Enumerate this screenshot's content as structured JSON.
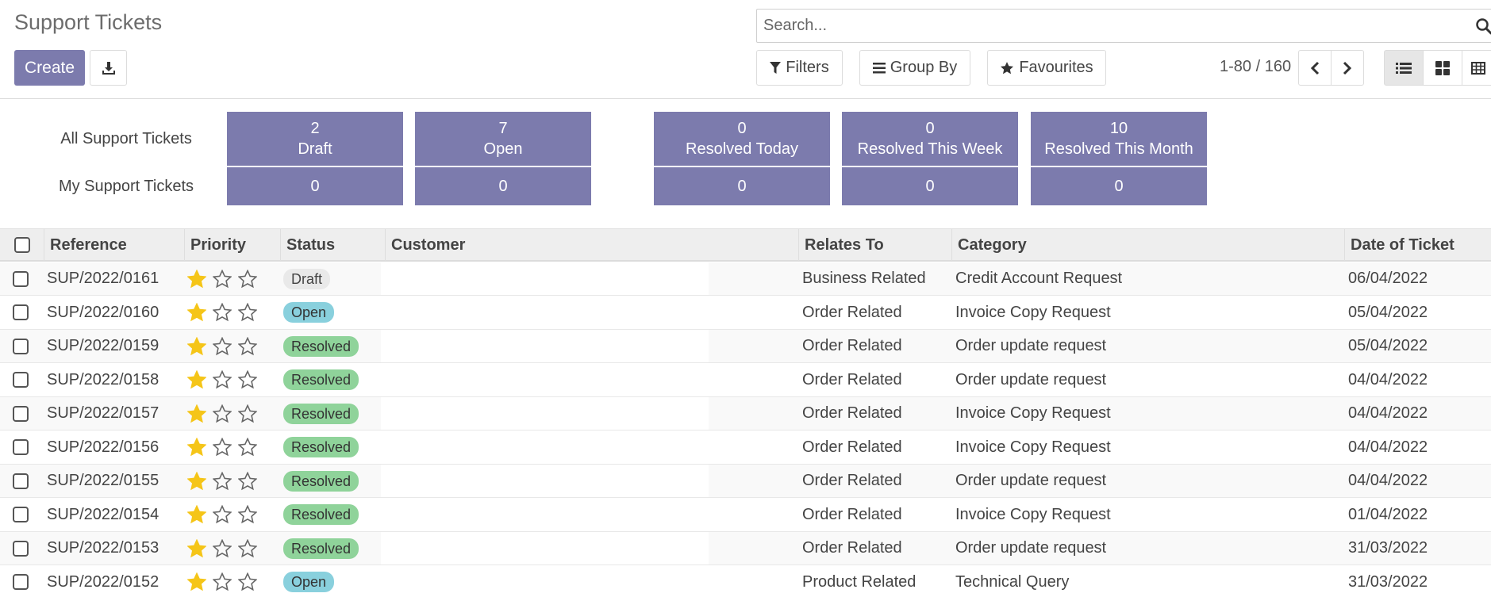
{
  "header": {
    "title": "Support Tickets",
    "create_label": "Create",
    "search_placeholder": "Search...",
    "filters_label": "Filters",
    "groupby_label": "Group By",
    "favourites_label": "Favourites",
    "pager": "1-80 / 160"
  },
  "dashboard": {
    "row_all_label": "All Support Tickets",
    "row_my_label": "My Support Tickets",
    "tiles": [
      {
        "name": "Draft",
        "all": "2",
        "mine": "0"
      },
      {
        "name": "Open",
        "all": "7",
        "mine": "0"
      },
      {
        "name": "Resolved Today",
        "all": "0",
        "mine": "0"
      },
      {
        "name": "Resolved This Week",
        "all": "0",
        "mine": "0"
      },
      {
        "name": "Resolved This Month",
        "all": "10",
        "mine": "0"
      }
    ],
    "tile_color": "#7c7bad"
  },
  "table": {
    "columns": [
      "Reference",
      "Priority",
      "Status",
      "Customer",
      "Relates To",
      "Category",
      "Date of Ticket"
    ],
    "rows": [
      {
        "reference": "SUP/2022/0161",
        "priority": 1,
        "status": "Draft",
        "relates_to": "Business Related",
        "category": "Credit Account Request",
        "date": "06/04/2022"
      },
      {
        "reference": "SUP/2022/0160",
        "priority": 1,
        "status": "Open",
        "relates_to": "Order Related",
        "category": "Invoice Copy Request",
        "date": "05/04/2022"
      },
      {
        "reference": "SUP/2022/0159",
        "priority": 1,
        "status": "Resolved",
        "relates_to": "Order Related",
        "category": "Order update request",
        "date": "05/04/2022"
      },
      {
        "reference": "SUP/2022/0158",
        "priority": 1,
        "status": "Resolved",
        "relates_to": "Order Related",
        "category": "Order update request",
        "date": "04/04/2022"
      },
      {
        "reference": "SUP/2022/0157",
        "priority": 1,
        "status": "Resolved",
        "relates_to": "Order Related",
        "category": "Invoice Copy Request",
        "date": "04/04/2022"
      },
      {
        "reference": "SUP/2022/0156",
        "priority": 1,
        "status": "Resolved",
        "relates_to": "Order Related",
        "category": "Invoice Copy Request",
        "date": "04/04/2022"
      },
      {
        "reference": "SUP/2022/0155",
        "priority": 1,
        "status": "Resolved",
        "relates_to": "Order Related",
        "category": "Order update request",
        "date": "04/04/2022"
      },
      {
        "reference": "SUP/2022/0154",
        "priority": 1,
        "status": "Resolved",
        "relates_to": "Order Related",
        "category": "Invoice Copy Request",
        "date": "01/04/2022"
      },
      {
        "reference": "SUP/2022/0153",
        "priority": 1,
        "status": "Resolved",
        "relates_to": "Order Related",
        "category": "Order update request",
        "date": "31/03/2022"
      },
      {
        "reference": "SUP/2022/0152",
        "priority": 1,
        "status": "Open",
        "relates_to": "Product Related",
        "category": "Technical Query",
        "date": "31/03/2022"
      }
    ]
  },
  "icons": {
    "download": "download-icon",
    "search": "search-icon",
    "filter": "filter-icon",
    "groupby": "bars-icon",
    "favourites": "star-icon",
    "prev": "chevron-left-icon",
    "next": "chevron-right-icon",
    "list_view": "list-view-icon",
    "kanban_view": "kanban-view-icon",
    "pivot_view": "table-view-icon"
  },
  "colors": {
    "accent": "#7c7bad",
    "star": "#f5c518",
    "badge_open": "#89d0dd",
    "badge_resolved": "#8fd39a",
    "badge_draft": "#e9e9e9"
  }
}
